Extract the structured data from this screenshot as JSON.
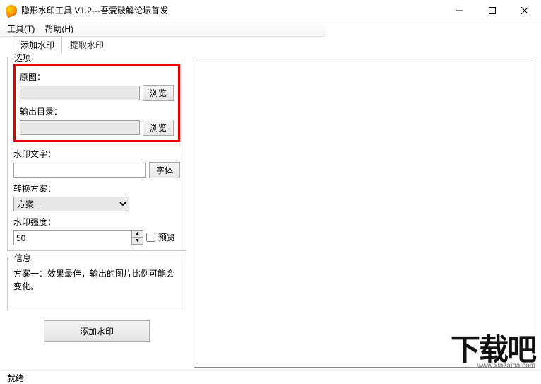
{
  "window": {
    "title": "隐形水印工具 V1.2---吾爱破解论坛首发"
  },
  "menu": {
    "tools": "工具(T)",
    "help": "帮助(H)"
  },
  "tabs": {
    "add": "添加水印",
    "extract": "提取水印"
  },
  "options": {
    "group_title": "选项",
    "original_label": "原图：",
    "browse1": "浏览",
    "output_label": "输出目录：",
    "browse2": "浏览",
    "text_label": "水印文字：",
    "font_btn": "字体",
    "scheme_label": "转换方案：",
    "scheme_value": "方案一",
    "strength_label": "水印强度：",
    "strength_value": "50",
    "preview_label": "预览"
  },
  "info": {
    "group_title": "信息",
    "text": "方案一：效果最佳，输出的图片比例可能会变化。"
  },
  "action": {
    "add_button": "添加水印"
  },
  "status": {
    "text": "就绪"
  },
  "watermark": {
    "logo": "下载吧",
    "url": "www.xiazaiba.com"
  }
}
